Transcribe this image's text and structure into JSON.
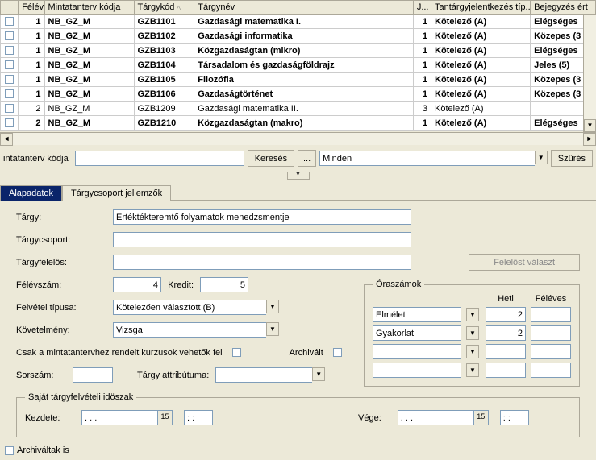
{
  "table": {
    "headers": {
      "felev": "Félév",
      "mkod": "Mintatanterv kódja",
      "tkod": "Tárgykód",
      "tnev": "Tárgynév",
      "j": "J...",
      "tip": "Tantárgyjelentkezés típ...",
      "bej": "Bejegyzés ért"
    },
    "rows": [
      {
        "bold": true,
        "felev": "1",
        "mkod": "NB_GZ_M",
        "tkod": "GZB1101",
        "tnev": "Gazdasági matematika I.",
        "j": "1",
        "tip": "Kötelező (A)",
        "bej": "Elégséges"
      },
      {
        "bold": true,
        "felev": "1",
        "mkod": "NB_GZ_M",
        "tkod": "GZB1102",
        "tnev": "Gazdasági informatika",
        "j": "1",
        "tip": "Kötelező (A)",
        "bej": "Közepes (3"
      },
      {
        "bold": true,
        "felev": "1",
        "mkod": "NB_GZ_M",
        "tkod": "GZB1103",
        "tnev": "Közgazdaságtan (mikro)",
        "j": "1",
        "tip": "Kötelező (A)",
        "bej": "Elégséges"
      },
      {
        "bold": true,
        "felev": "1",
        "mkod": "NB_GZ_M",
        "tkod": "GZB1104",
        "tnev": "Társadalom és gazdaságföldrajz",
        "j": "1",
        "tip": "Kötelező (A)",
        "bej": "Jeles (5)"
      },
      {
        "bold": true,
        "felev": "1",
        "mkod": "NB_GZ_M",
        "tkod": "GZB1105",
        "tnev": "Filozófia",
        "j": "1",
        "tip": "Kötelező (A)",
        "bej": "Közepes (3"
      },
      {
        "bold": true,
        "felev": "1",
        "mkod": "NB_GZ_M",
        "tkod": "GZB1106",
        "tnev": "Gazdaságtörténet",
        "j": "1",
        "tip": "Kötelező (A)",
        "bej": "Közepes (3"
      },
      {
        "bold": false,
        "felev": "2",
        "mkod": "NB_GZ_M",
        "tkod": "GZB1209",
        "tnev": "Gazdasági matematika II.",
        "j": "3",
        "tip": "Kötelező (A)",
        "bej": ""
      },
      {
        "bold": true,
        "felev": "2",
        "mkod": "NB_GZ_M",
        "tkod": "GZB1210",
        "tnev": "Közgazdaságtan (makro)",
        "j": "1",
        "tip": "Kötelező (A)",
        "bej": "Elégséges"
      }
    ]
  },
  "search": {
    "label": "intatanterv kódja",
    "kereses": "Keresés",
    "dots": "...",
    "minden": "Minden",
    "szures": "Szűrés"
  },
  "tabs": {
    "alapadatok": "Alapadatok",
    "targycsoport": "Tárgycsoport jellemzők"
  },
  "form": {
    "targy_lbl": "Tárgy:",
    "targy_val": "Értéktékteremtő folyamatok menedzsmentje",
    "targycsoport_lbl": "Tárgycsoport:",
    "targyfelelos_lbl": "Tárgyfelelős:",
    "felelost_valaszt": "Felelőst választ",
    "felevszam_lbl": "Félévszám:",
    "felevszam_val": "4",
    "kredit_lbl": "Kredit:",
    "kredit_val": "5",
    "felvetel_lbl": "Felvétel típusa:",
    "felvetel_val": "Kötelezően választott (B)",
    "kovetelmeny_lbl": "Követelmény:",
    "kovetelmeny_val": "Vizsga",
    "csak_lbl": "Csak a mintatantervhez rendelt kurzusok vehetők fel",
    "archivalt_lbl": "Archivált",
    "sorszam_lbl": "Sorszám:",
    "targy_attr_lbl": "Tárgy attribútuma:"
  },
  "oraszamok": {
    "legend": "Óraszámok",
    "heti": "Heti",
    "feleves": "Féléves",
    "elmelet": "Elmélet",
    "elmelet_heti": "2",
    "gyakorlat": "Gyakorlat",
    "gyakorlat_heti": "2"
  },
  "idoszak": {
    "legend": "Saját tárgyfelvételi idöszak",
    "kezdete": "Kezdete:",
    "vege": "Vége:",
    "date_ph": ". . .",
    "time_ph": ": :"
  },
  "footer": {
    "archivaltak": "Archiváltak is"
  }
}
